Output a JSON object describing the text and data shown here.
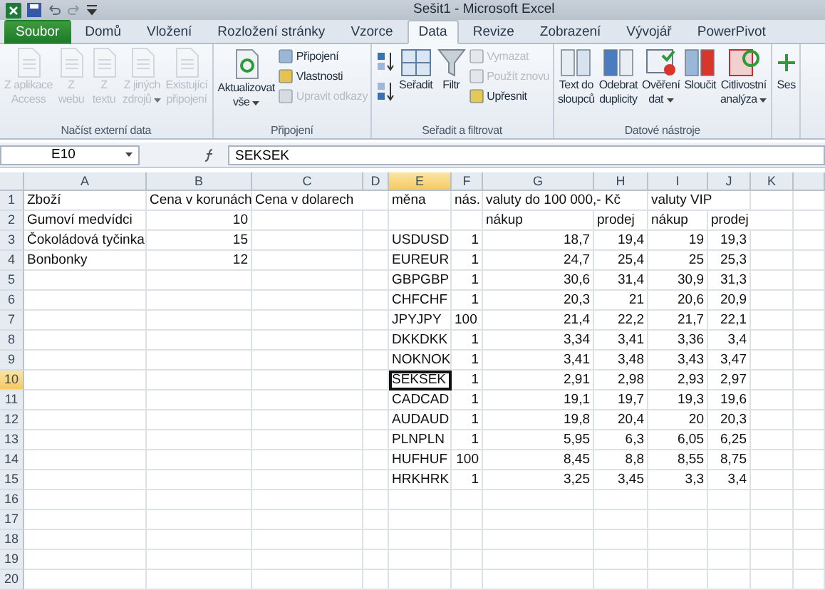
{
  "title_bar": {
    "title": "Sešit1 - Microsoft Excel"
  },
  "tabs": [
    {
      "label": "Soubor",
      "kind": "file",
      "selected": false
    },
    {
      "label": "Domů",
      "kind": "tab",
      "selected": false
    },
    {
      "label": "Vložení",
      "kind": "tab",
      "selected": false
    },
    {
      "label": "Rozložení stránky",
      "kind": "tab",
      "selected": false
    },
    {
      "label": "Vzorce",
      "kind": "tab",
      "selected": false
    },
    {
      "label": "Data",
      "kind": "tab",
      "selected": true
    },
    {
      "label": "Revize",
      "kind": "tab",
      "selected": false
    },
    {
      "label": "Zobrazení",
      "kind": "tab",
      "selected": false
    },
    {
      "label": "Vývojář",
      "kind": "tab",
      "selected": false
    },
    {
      "label": "PowerPivot",
      "kind": "tab",
      "selected": false
    }
  ],
  "ribbon": {
    "groups": [
      {
        "label": "Načíst externí data",
        "buttons": [
          {
            "kind": "large",
            "lines": [
              "Z aplikace",
              "Access"
            ],
            "disabled": true,
            "dropdown": false
          },
          {
            "kind": "large",
            "lines": [
              "Z",
              "webu"
            ],
            "disabled": true,
            "dropdown": false
          },
          {
            "kind": "large",
            "lines": [
              "Z",
              "textu"
            ],
            "disabled": true,
            "dropdown": false
          },
          {
            "kind": "large",
            "lines": [
              "Z jiných",
              "zdrojů"
            ],
            "disabled": true,
            "dropdown": true
          },
          {
            "kind": "large",
            "lines": [
              "Existující",
              "připojení"
            ],
            "disabled": true,
            "dropdown": false
          }
        ]
      },
      {
        "label": "Připojení",
        "buttons": [
          {
            "kind": "large",
            "lines": [
              "Aktualizovat",
              "vše"
            ],
            "disabled": false,
            "dropdown": true
          },
          {
            "kind": "small",
            "lines": [
              "Připojení"
            ],
            "disabled": false,
            "dropdown": false
          },
          {
            "kind": "small",
            "lines": [
              "Vlastnosti"
            ],
            "disabled": false,
            "dropdown": false
          },
          {
            "kind": "small",
            "lines": [
              "Upravit odkazy"
            ],
            "disabled": true,
            "dropdown": false
          }
        ]
      },
      {
        "label": "Seřadit a filtrovat",
        "buttons": [
          {
            "kind": "icon",
            "disabled": false,
            "dropdown": false
          },
          {
            "kind": "icon",
            "disabled": false,
            "dropdown": false
          },
          {
            "kind": "large",
            "lines": [
              "Seřadit"
            ],
            "disabled": false,
            "dropdown": false
          },
          {
            "kind": "large",
            "lines": [
              "Filtr"
            ],
            "disabled": false,
            "dropdown": false
          },
          {
            "kind": "small",
            "lines": [
              "Vymazat"
            ],
            "disabled": true,
            "dropdown": false
          },
          {
            "kind": "small",
            "lines": [
              "Použít znovu"
            ],
            "disabled": true,
            "dropdown": false
          },
          {
            "kind": "small",
            "lines": [
              "Upřesnit"
            ],
            "disabled": false,
            "dropdown": false
          }
        ]
      },
      {
        "label": "Datové nástroje",
        "buttons": [
          {
            "kind": "large",
            "lines": [
              "Text do",
              "sloupců"
            ],
            "disabled": false,
            "dropdown": false
          },
          {
            "kind": "large",
            "lines": [
              "Odebrat",
              "duplicity"
            ],
            "disabled": false,
            "dropdown": false
          },
          {
            "kind": "large",
            "lines": [
              "Ověření",
              "dat"
            ],
            "disabled": false,
            "dropdown": true
          },
          {
            "kind": "large",
            "lines": [
              "Sloučit"
            ],
            "disabled": false,
            "dropdown": false
          },
          {
            "kind": "large",
            "lines": [
              "Citlivostní",
              "analýza"
            ],
            "disabled": false,
            "dropdown": true
          }
        ]
      },
      {
        "buttons": [
          {
            "kind": "large",
            "lines": [
              "Ses"
            ],
            "disabled": false,
            "dropdown": false
          }
        ]
      }
    ]
  },
  "formula_bar": {
    "name_box": "E10",
    "formula": "SEKSEK"
  },
  "sheet": {
    "columns": [
      {
        "label": "A",
        "selected": false
      },
      {
        "label": "B",
        "selected": false
      },
      {
        "label": "C",
        "selected": false
      },
      {
        "label": "D",
        "selected": false
      },
      {
        "label": "E",
        "selected": true
      },
      {
        "label": "F",
        "selected": false
      },
      {
        "label": "G",
        "selected": false
      },
      {
        "label": "H",
        "selected": false
      },
      {
        "label": "I",
        "selected": false
      },
      {
        "label": "J",
        "selected": false
      },
      {
        "label": "K",
        "selected": false
      }
    ],
    "rows": [
      {
        "label": "1",
        "selected": false,
        "cells": [
          {
            "text": "Zboží",
            "kind": "text",
            "selected": false
          },
          {
            "text": "Cena v korunách",
            "kind": "text",
            "selected": false
          },
          {
            "text": "Cena v dolarech",
            "kind": "text",
            "selected": false
          },
          null,
          {
            "text": "měna",
            "kind": "text",
            "selected": false
          },
          {
            "text": "nás.",
            "kind": "text",
            "selected": false
          },
          {
            "text": "valuty do 100 000,- Kč",
            "kind": "text",
            "selected": false
          },
          null,
          {
            "text": "valuty VIP",
            "kind": "text",
            "selected": false
          }
        ]
      },
      {
        "label": "2",
        "selected": false,
        "cells": [
          {
            "text": "Gumoví medvídci",
            "kind": "text",
            "selected": false
          },
          {
            "text": "10",
            "kind": "number",
            "selected": false
          },
          null,
          null,
          null,
          null,
          {
            "text": "nákup",
            "kind": "text",
            "selected": false
          },
          {
            "text": "prodej",
            "kind": "text",
            "selected": false
          },
          {
            "text": "nákup",
            "kind": "text",
            "selected": false
          },
          {
            "text": "prodej",
            "kind": "text",
            "selected": false
          }
        ]
      },
      {
        "label": "3",
        "selected": false,
        "cells": [
          {
            "text": "Čokoládová tyčinka",
            "kind": "text",
            "selected": false
          },
          {
            "text": "15",
            "kind": "number",
            "selected": false
          },
          null,
          null,
          {
            "text": "USDUSD",
            "kind": "text",
            "selected": false
          },
          {
            "text": "1",
            "kind": "number",
            "selected": false
          },
          {
            "text": "18,7",
            "kind": "number",
            "selected": false
          },
          {
            "text": "19,4",
            "kind": "number",
            "selected": false
          },
          {
            "text": "19",
            "kind": "number",
            "selected": false
          },
          {
            "text": "19,3",
            "kind": "number",
            "selected": false
          }
        ]
      },
      {
        "label": "4",
        "selected": false,
        "cells": [
          {
            "text": "Bonbonky",
            "kind": "text",
            "selected": false
          },
          {
            "text": "12",
            "kind": "number",
            "selected": false
          },
          null,
          null,
          {
            "text": "EUREUR",
            "kind": "text",
            "selected": false
          },
          {
            "text": "1",
            "kind": "number",
            "selected": false
          },
          {
            "text": "24,7",
            "kind": "number",
            "selected": false
          },
          {
            "text": "25,4",
            "kind": "number",
            "selected": false
          },
          {
            "text": "25",
            "kind": "number",
            "selected": false
          },
          {
            "text": "25,3",
            "kind": "number",
            "selected": false
          }
        ]
      },
      {
        "label": "5",
        "selected": false,
        "cells": [
          null,
          null,
          null,
          null,
          {
            "text": "GBPGBP",
            "kind": "text",
            "selected": false
          },
          {
            "text": "1",
            "kind": "number",
            "selected": false
          },
          {
            "text": "30,6",
            "kind": "number",
            "selected": false
          },
          {
            "text": "31,4",
            "kind": "number",
            "selected": false
          },
          {
            "text": "30,9",
            "kind": "number",
            "selected": false
          },
          {
            "text": "31,3",
            "kind": "number",
            "selected": false
          }
        ]
      },
      {
        "label": "6",
        "selected": false,
        "cells": [
          null,
          null,
          null,
          null,
          {
            "text": "CHFCHF",
            "kind": "text",
            "selected": false
          },
          {
            "text": "1",
            "kind": "number",
            "selected": false
          },
          {
            "text": "20,3",
            "kind": "number",
            "selected": false
          },
          {
            "text": "21",
            "kind": "number",
            "selected": false
          },
          {
            "text": "20,6",
            "kind": "number",
            "selected": false
          },
          {
            "text": "20,9",
            "kind": "number",
            "selected": false
          }
        ]
      },
      {
        "label": "7",
        "selected": false,
        "cells": [
          null,
          null,
          null,
          null,
          {
            "text": "JPYJPY",
            "kind": "text",
            "selected": false
          },
          {
            "text": "100",
            "kind": "text",
            "selected": false
          },
          {
            "text": "21,4",
            "kind": "number",
            "selected": false
          },
          {
            "text": "22,2",
            "kind": "number",
            "selected": false
          },
          {
            "text": "21,7",
            "kind": "number",
            "selected": false
          },
          {
            "text": "22,1",
            "kind": "number",
            "selected": false
          }
        ]
      },
      {
        "label": "8",
        "selected": false,
        "cells": [
          null,
          null,
          null,
          null,
          {
            "text": "DKKDKK",
            "kind": "text",
            "selected": false
          },
          {
            "text": "1",
            "kind": "number",
            "selected": false
          },
          {
            "text": "3,34",
            "kind": "number",
            "selected": false
          },
          {
            "text": "3,41",
            "kind": "number",
            "selected": false
          },
          {
            "text": "3,36",
            "kind": "number",
            "selected": false
          },
          {
            "text": "3,4",
            "kind": "number",
            "selected": false
          }
        ]
      },
      {
        "label": "9",
        "selected": false,
        "cells": [
          null,
          null,
          null,
          null,
          {
            "text": "NOKNOK",
            "kind": "text",
            "selected": false
          },
          {
            "text": "1",
            "kind": "number",
            "selected": false
          },
          {
            "text": "3,41",
            "kind": "number",
            "selected": false
          },
          {
            "text": "3,48",
            "kind": "number",
            "selected": false
          },
          {
            "text": "3,43",
            "kind": "number",
            "selected": false
          },
          {
            "text": "3,47",
            "kind": "number",
            "selected": false
          }
        ]
      },
      {
        "label": "10",
        "selected": true,
        "cells": [
          null,
          null,
          null,
          null,
          {
            "text": "SEKSEK",
            "kind": "text",
            "selected": true
          },
          {
            "text": "1",
            "kind": "number",
            "selected": false
          },
          {
            "text": "2,91",
            "kind": "number",
            "selected": false
          },
          {
            "text": "2,98",
            "kind": "number",
            "selected": false
          },
          {
            "text": "2,93",
            "kind": "number",
            "selected": false
          },
          {
            "text": "2,97",
            "kind": "number",
            "selected": false
          }
        ]
      },
      {
        "label": "11",
        "selected": false,
        "cells": [
          null,
          null,
          null,
          null,
          {
            "text": "CADCAD",
            "kind": "text",
            "selected": false
          },
          {
            "text": "1",
            "kind": "number",
            "selected": false
          },
          {
            "text": "19,1",
            "kind": "number",
            "selected": false
          },
          {
            "text": "19,7",
            "kind": "number",
            "selected": false
          },
          {
            "text": "19,3",
            "kind": "number",
            "selected": false
          },
          {
            "text": "19,6",
            "kind": "number",
            "selected": false
          }
        ]
      },
      {
        "label": "12",
        "selected": false,
        "cells": [
          null,
          null,
          null,
          null,
          {
            "text": "AUDAUD",
            "kind": "text",
            "selected": false
          },
          {
            "text": "1",
            "kind": "number",
            "selected": false
          },
          {
            "text": "19,8",
            "kind": "number",
            "selected": false
          },
          {
            "text": "20,4",
            "kind": "number",
            "selected": false
          },
          {
            "text": "20",
            "kind": "number",
            "selected": false
          },
          {
            "text": "20,3",
            "kind": "number",
            "selected": false
          }
        ]
      },
      {
        "label": "13",
        "selected": false,
        "cells": [
          null,
          null,
          null,
          null,
          {
            "text": "PLNPLN",
            "kind": "text",
            "selected": false
          },
          {
            "text": "1",
            "kind": "number",
            "selected": false
          },
          {
            "text": "5,95",
            "kind": "number",
            "selected": false
          },
          {
            "text": "6,3",
            "kind": "number",
            "selected": false
          },
          {
            "text": "6,05",
            "kind": "number",
            "selected": false
          },
          {
            "text": "6,25",
            "kind": "number",
            "selected": false
          }
        ]
      },
      {
        "label": "14",
        "selected": false,
        "cells": [
          null,
          null,
          null,
          null,
          {
            "text": "HUFHUF",
            "kind": "text",
            "selected": false
          },
          {
            "text": "100",
            "kind": "number",
            "selected": false
          },
          {
            "text": "8,45",
            "kind": "number",
            "selected": false
          },
          {
            "text": "8,8",
            "kind": "number",
            "selected": false
          },
          {
            "text": "8,55",
            "kind": "number",
            "selected": false
          },
          {
            "text": "8,75",
            "kind": "number",
            "selected": false
          }
        ]
      },
      {
        "label": "15",
        "selected": false,
        "cells": [
          null,
          null,
          null,
          null,
          {
            "text": "HRKHRK",
            "kind": "text",
            "selected": false
          },
          {
            "text": "1",
            "kind": "number",
            "selected": false
          },
          {
            "text": "3,25",
            "kind": "number",
            "selected": false
          },
          {
            "text": "3,45",
            "kind": "number",
            "selected": false
          },
          {
            "text": "3,3",
            "kind": "number",
            "selected": false
          },
          {
            "text": "3,4",
            "kind": "number",
            "selected": false
          }
        ]
      },
      {
        "label": "16",
        "selected": false
      },
      {
        "label": "17",
        "selected": false
      },
      {
        "label": "18",
        "selected": false
      },
      {
        "label": "19",
        "selected": false
      },
      {
        "label": "20",
        "selected": false
      }
    ]
  }
}
